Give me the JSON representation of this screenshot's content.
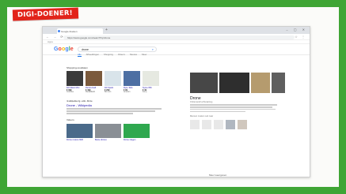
{
  "badge": {
    "text": "DIGI-DOENER!"
  },
  "browser": {
    "tab_title": "Google Zoeken",
    "url": "https://www.google.com/search?q=drone",
    "new_tab": "+",
    "window_controls": "– ▢ ✕",
    "nav": "← → ⟳",
    "toolbar_icons": "☆ ⋮",
    "bookmarks_text": "Apps"
  },
  "google": {
    "logo_letters": [
      {
        "l": "G",
        "c": "#4285f4"
      },
      {
        "l": "o",
        "c": "#ea4335"
      },
      {
        "l": "o",
        "c": "#fbbc05"
      },
      {
        "l": "g",
        "c": "#4285f4"
      },
      {
        "l": "l",
        "c": "#34a853"
      },
      {
        "l": "e",
        "c": "#ea4335"
      }
    ],
    "query": "drone",
    "tabs": [
      {
        "label": "Alle",
        "active": true
      },
      {
        "label": "Afbeeldingen",
        "active": false
      },
      {
        "label": "Shopping",
        "active": false
      },
      {
        "label": "Video's",
        "active": false
      },
      {
        "label": "Nieuws",
        "active": false
      },
      {
        "label": "Meer",
        "active": false
      }
    ],
    "shopping_label": "Shopping-resultaten",
    "products": [
      {
        "title": "DJI Mavic Mini",
        "price": "€ 399",
        "store": "Coolblue",
        "color": "#3a3a3a"
      },
      {
        "title": "Parrot Anafi",
        "price": "€ 499",
        "store": "MediaMarkt",
        "color": "#7b5a3c"
      },
      {
        "title": "DJI Spark",
        "price": "€ 299",
        "store": "Bol.com",
        "color": "#d9e4ea"
      },
      {
        "title": "Ryze Tello",
        "price": "€ 99",
        "store": "Amazon",
        "color": "#4d6fa3"
      },
      {
        "title": "Syma X5C",
        "price": "€ 49",
        "store": "Fonq",
        "color": "#e6e9e1"
      }
    ],
    "web_result": {
      "url": "nl.wikipedia.org › wiki › Drone",
      "title": "Drone - Wikipedia"
    },
    "videos_label": "Video's",
    "videos": [
      {
        "title": "Drone review 2020",
        "color": "#4a6a8a"
      },
      {
        "title": "Beste drones",
        "color": "#8a8f95"
      },
      {
        "title": "Drone vliegen",
        "color": "#2fa84f"
      }
    ],
    "knowledge_title": "Drone",
    "knowledge_sub": "Onbemand luchtvaartuig",
    "related_label": "Mensen zoeken ook naar",
    "continue": "Meer weergeven"
  }
}
